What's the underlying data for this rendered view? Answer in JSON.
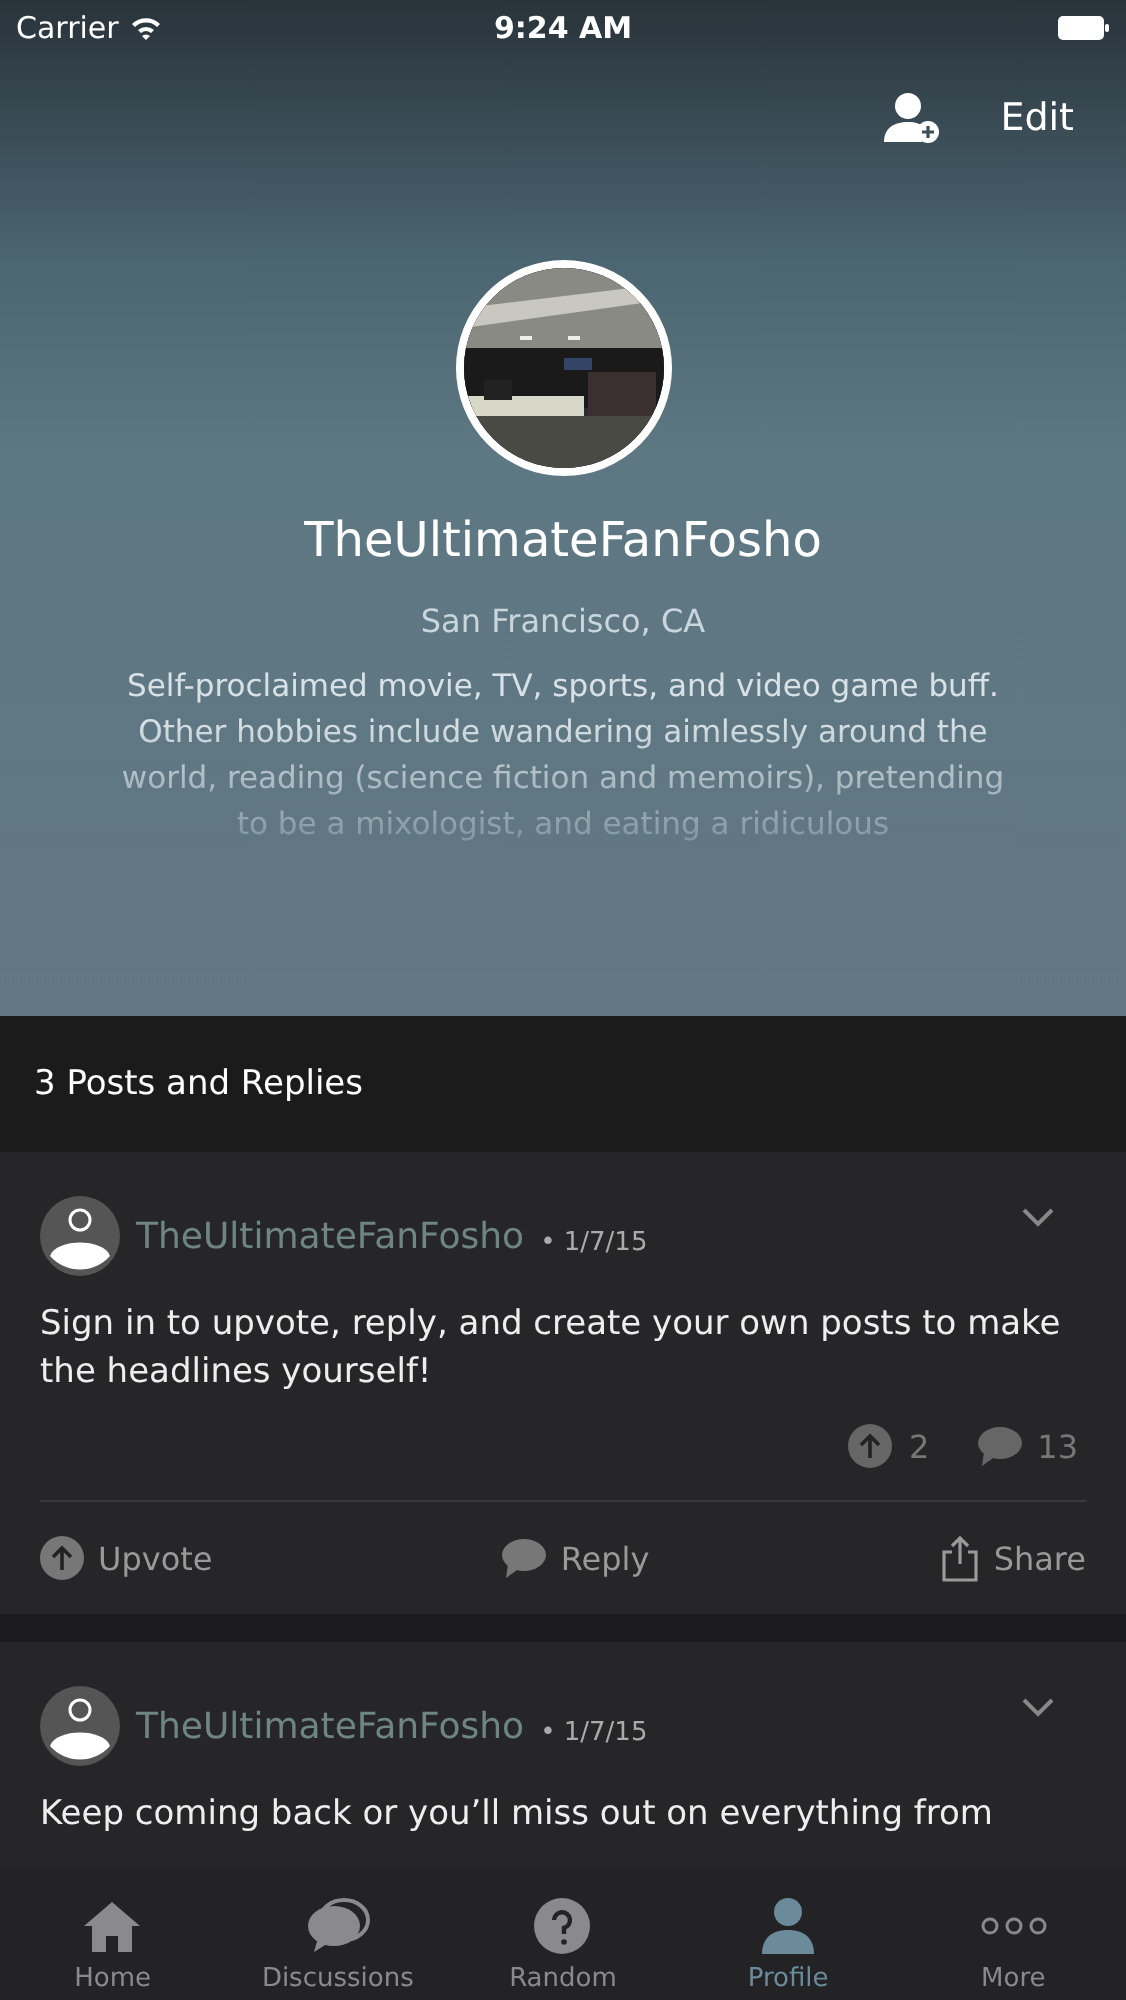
{
  "status_bar": {
    "carrier": "Carrier",
    "time": "9:24 AM"
  },
  "header": {
    "edit": "Edit"
  },
  "profile": {
    "name": "TheUltimateFanFosho",
    "location": "San Francisco, CA",
    "bio": "Self-proclaimed movie, TV, sports, and video game buff. Other hobbies include wandering aimlessly around the world, reading (science fiction and memoirs), pretending to be a mixologist, and eating a ridiculous"
  },
  "section_title": "3 Posts and Replies",
  "posts": [
    {
      "author": "TheUltimateFanFosho",
      "date": "• 1/7/15",
      "text": "Sign in to upvote, reply, and create your own posts to make the headlines yourself!",
      "upvotes": "2",
      "replies": "13",
      "actions": [
        "Upvote",
        "Reply",
        "Share"
      ]
    },
    {
      "author": "TheUltimateFanFosho",
      "date": "• 1/7/15",
      "text": "Keep coming back or you’ll miss out on everything from"
    }
  ],
  "tabs": [
    {
      "kind": "home",
      "label": "Home",
      "selected": false
    },
    {
      "kind": "discussions",
      "label": "Discussions",
      "selected": false
    },
    {
      "kind": "random",
      "label": "Random",
      "selected": false
    },
    {
      "kind": "profile",
      "label": "Profile",
      "selected": true
    },
    {
      "kind": "more",
      "label": "More",
      "selected": false
    }
  ]
}
